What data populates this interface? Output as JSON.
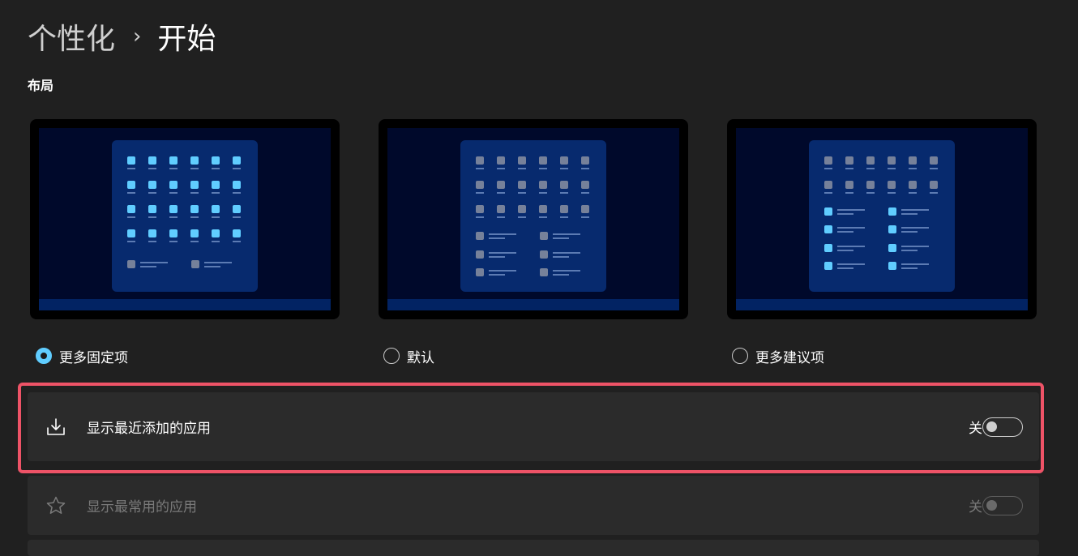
{
  "breadcrumb": {
    "parent": "个性化",
    "separator": "›",
    "current": "开始"
  },
  "layout_section": {
    "label": "布局",
    "options": [
      {
        "id": "more-pins",
        "label": "更多固定项",
        "selected": true,
        "icon": "layout-more-pins-preview"
      },
      {
        "id": "default",
        "label": "默认",
        "selected": false,
        "icon": "layout-default-preview"
      },
      {
        "id": "more-recommendations",
        "label": "更多建议项",
        "selected": false,
        "icon": "layout-more-recommendations-preview"
      }
    ]
  },
  "settings": [
    {
      "id": "recently-added",
      "label": "显示最近添加的应用",
      "state_label": "关",
      "on": false,
      "icon": "download-icon",
      "highlighted": true,
      "enabled": true
    },
    {
      "id": "most-used",
      "label": "显示最常用的应用",
      "state_label": "关",
      "on": false,
      "icon": "star-icon",
      "highlighted": false,
      "enabled": false
    }
  ],
  "colors": {
    "accent": "#60cdff",
    "highlight_border": "#ee5367",
    "background": "#202020",
    "card": "#2b2b2b"
  }
}
